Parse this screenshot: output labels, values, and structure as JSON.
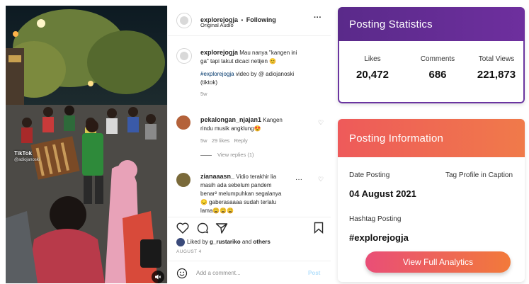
{
  "video": {
    "watermark_brand": "TikTok",
    "watermark_user": "@adiojanoski",
    "mute_icon": "speaker-muted-icon"
  },
  "post": {
    "username": "explorejogja",
    "separator": "•",
    "follow_status": "Following",
    "audio": "Original Audio",
    "more_icon": "ellipsis-icon"
  },
  "caption": {
    "username": "explorejogja",
    "text_line1": "Mau nanya \"kangen ini",
    "text_line2": "ga\" tapi takut dicaci netijen 😊",
    "hashtag": "#explorejogja",
    "credit_line1": " video by @ adiojanoski",
    "credit_line2": "(tiktok)",
    "time": "5w"
  },
  "comments": [
    {
      "username": "pekalongan_njajan1",
      "line1": " Kangen",
      "line2": "rindu musik angklung😍",
      "time": "5w",
      "likes": "29 likes",
      "reply": "Reply",
      "view_replies": "View replies (1)"
    },
    {
      "username": "zianaaasn_",
      "line1": " Vidio terakhir lia",
      "line2": "masih ada sebelum pandem",
      "line3": "benar² melumpuhkan segalanya",
      "line4": "😔 gaberasaaaa sudah terlalu",
      "line5": "lama😩😩😩"
    }
  ],
  "actions": {
    "liked_by_prefix": "Liked by ",
    "liked_by_user": "g_rustariko",
    "liked_by_and": " and ",
    "liked_by_others": "others",
    "date": "AUGUST 4",
    "comment_placeholder": "Add a comment...",
    "post_button": "Post"
  },
  "statistics": {
    "title": "Posting Statistics",
    "items": [
      {
        "label": "Likes",
        "value": "20,472"
      },
      {
        "label": "Comments",
        "value": "686"
      },
      {
        "label": "Total Views",
        "value": "221,873"
      }
    ],
    "header_color": "#5a2a8a"
  },
  "information": {
    "title": "Posting Information",
    "date_label": "Date Posting",
    "tag_label": "Tag Profile in Caption",
    "date_value": "04 August 2021",
    "hashtag_label": "Hashtag Posting",
    "hashtag_value": "#explorejogja",
    "cta": "View Full Analytics",
    "header_color": "#ee5a5a"
  }
}
